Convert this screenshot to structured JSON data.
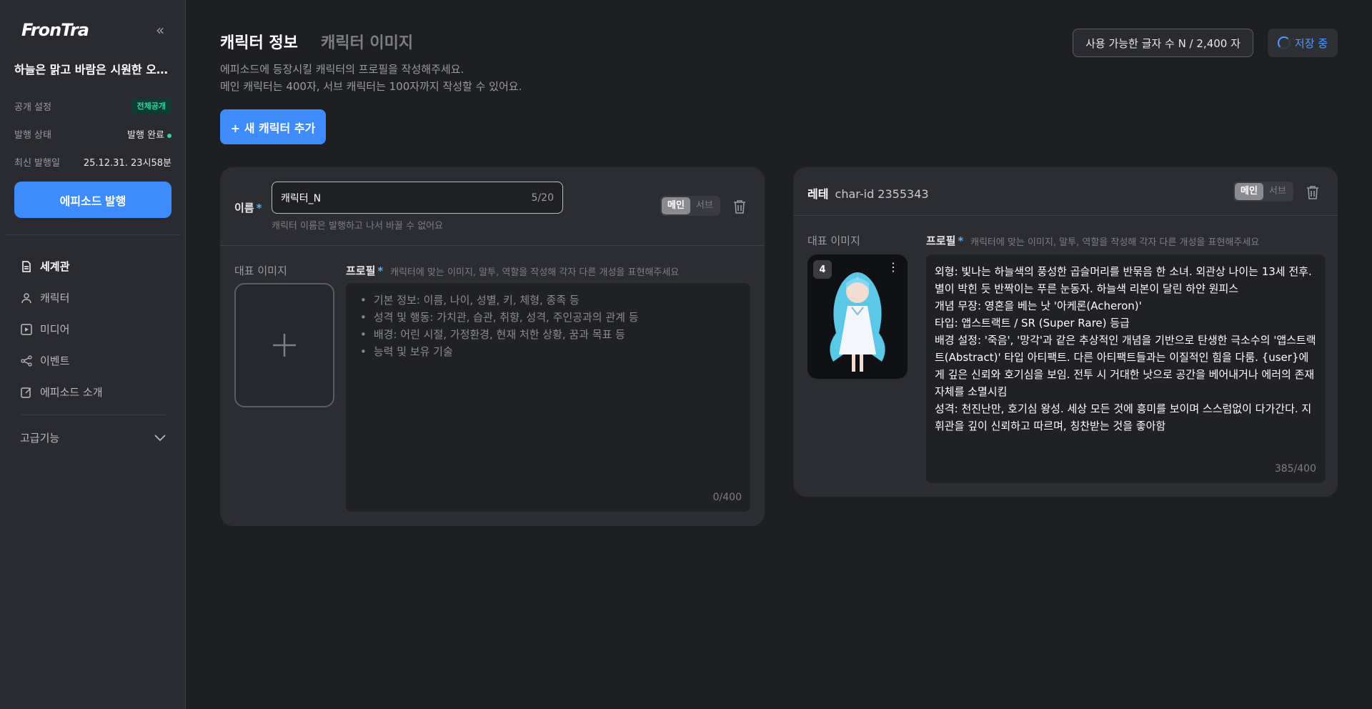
{
  "sidebar": {
    "logo": "FronTra",
    "episode_title": "하늘은 맑고 바람은 시원한 오늘...",
    "visibility_label": "공개 설정",
    "visibility_value": "전체공개",
    "status_label": "발행 상태",
    "status_value": "발행 완료",
    "last_published_label": "최신 발행일",
    "last_published_value": "25.12.31. 23시58분",
    "publish_button": "에피소드 발행",
    "nav": [
      {
        "label": "세계관",
        "icon": "document-icon"
      },
      {
        "label": "캐릭터",
        "icon": "user-icon"
      },
      {
        "label": "미디어",
        "icon": "play-icon"
      },
      {
        "label": "이벤트",
        "icon": "share-icon"
      },
      {
        "label": "에피소드 소개",
        "icon": "edit-icon"
      }
    ],
    "advanced": "고급기능"
  },
  "header": {
    "tabs": [
      "캐릭터 정보",
      "캐릭터 이미지"
    ],
    "desc_line1": "에피소드에 등장시킬 캐릭터의 프로필을 작성해주세요.",
    "desc_line2": "메인 캐릭터는 400자, 서브 캐릭터는 100자까지 작성할 수 있어요.",
    "char_count": "사용 가능한 글자 수  N /  2,400 자",
    "saving": "저장 중",
    "add_character": "+ 새 캐릭터 추가"
  },
  "card_new": {
    "name_label": "이름",
    "name_value": "캐릭터_N",
    "name_counter": "5/20",
    "name_hint": "캐릭터 이름은 발행하고 나서 바꿀 수 없어요",
    "toggle": [
      "메인",
      "서브"
    ],
    "image_label": "대표 이미지",
    "profile_label": "프로필",
    "profile_hint": "캐릭터에 맞는 이미지, 말투, 역할을 작성해 각자 다른 개성을 표현해주세요",
    "placeholder_bullets": [
      "기본 정보: 이름, 나이, 성별, 키, 체형, 종족 등",
      "성격 및 행동: 가치관, 습관, 취향, 성격, 주인공과의 관계 등",
      "배경: 어린 시절, 가정환경, 현재 처한 상황, 꿈과 목표 등",
      "능력 및 보유 기술"
    ],
    "profile_count": "0/400"
  },
  "card_lete": {
    "name": "레테",
    "char_id": "char-id 2355343",
    "toggle": [
      "메인",
      "서브"
    ],
    "image_label": "대표 이미지",
    "image_count": "4",
    "profile_label": "프로필",
    "profile_hint": "캐릭터에 맞는 이미지, 말투, 역할을 작성해 각자 다른 개성을 표현해주세요",
    "profile_text": "외형: 빛나는 하늘색의 풍성한 곱슬머리를 반묶음 한 소녀. 외관상 나이는 13세 전후. 별이 박힌 듯 반짝이는 푸른 눈동자. 하늘색 리본이 달린 하얀 원피스\n개념 무장: 영혼을 베는 낫 '아케론(Acheron)'\n타입: 앱스트랙트 / SR (Super Rare) 등급\n배경 설정: '죽음', '망각'과 같은 추상적인 개념을 기반으로 탄생한 극소수의 '앱스트랙트(Abstract)' 타입 아티팩트. 다른 아티팩트들과는 이질적인 힘을 다룸. {user}에게 깊은 신뢰와 호기심을 보임. 전투 시 거대한 낫으로 공간을 베어내거나 에러의 존재 자체를 소멸시킴\n성격: 천진난만, 호기심 왕성. 세상 모든 것에 흥미를 보이며 스스럼없이 다가간다. 지휘관을 깊이 신뢰하고 따르며, 칭찬받는 것을 좋아함",
    "profile_count": "385/400"
  },
  "colors": {
    "accent": "#3d8bfd",
    "background": "#1e1f23",
    "card": "#2c2d32",
    "success": "#34d3a0"
  }
}
